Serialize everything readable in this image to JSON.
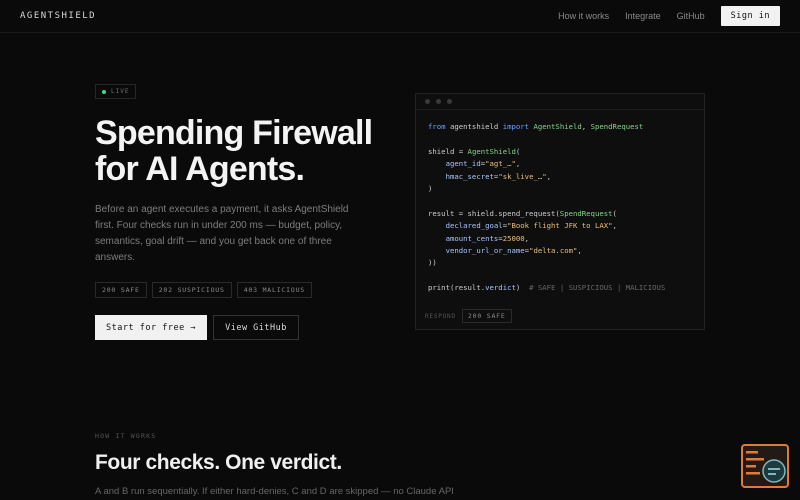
{
  "nav": {
    "brand": "AGENTSHIELD",
    "links": [
      "How it works",
      "Integrate",
      "GitHub"
    ],
    "signin": "Sign in"
  },
  "hero": {
    "badge": "LIVE",
    "title_line1": "Spending Firewall",
    "title_line2": "for AI Agents.",
    "description": "Before an agent executes a payment, it asks AgentShield first. Four checks run in under 200 ms — budget, policy, semantics, goal drift — and you get back one of three answers.",
    "codes": [
      "200 SAFE",
      "202 SUSPICIOUS",
      "403 MALICIOUS"
    ],
    "cta_primary": "Start for free →",
    "cta_secondary": "View GitHub"
  },
  "code_window": {
    "response_label": "RESPOND",
    "response_value": "200 SAFE"
  },
  "how_it_works": {
    "label": "HOW IT WORKS",
    "title": "Four checks. One verdict.",
    "description": "A and B run sequentially. If either hard-denies, C and D are skipped — no Claude API"
  },
  "colors": {
    "live_dot": "#3ddc84",
    "keyword": "#6aa2ff",
    "class": "#86d38b",
    "string": "#e8c07a",
    "widget_accent": "#e07a3a"
  }
}
